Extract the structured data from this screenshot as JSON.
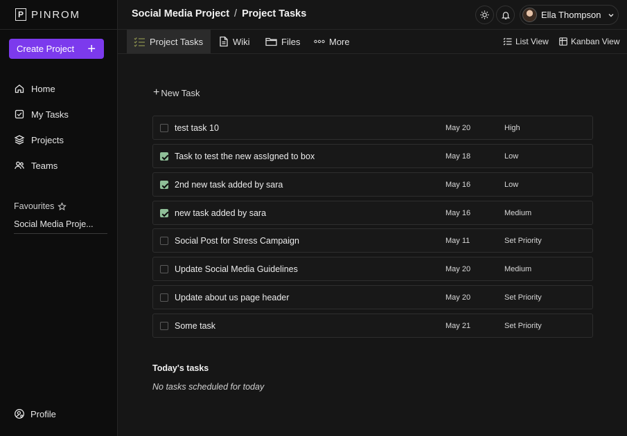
{
  "brand": {
    "logo_letter": "P",
    "name": "PINROM"
  },
  "sidebar": {
    "create_label": "Create Project",
    "nav": [
      {
        "label": "Home",
        "icon": "home-icon"
      },
      {
        "label": "My Tasks",
        "icon": "checkbox-icon"
      },
      {
        "label": "Projects",
        "icon": "layers-icon"
      },
      {
        "label": "Teams",
        "icon": "users-icon"
      }
    ],
    "favourites_label": "Favourites",
    "favourite_items": [
      "Social Media Proje..."
    ],
    "profile_label": "Profile"
  },
  "header": {
    "breadcrumb": [
      "Social Media Project",
      "Project Tasks"
    ],
    "separator": "/",
    "user_name": "Ella Thompson"
  },
  "tabs": [
    {
      "label": "Project Tasks",
      "active": true,
      "icon": "task-list-icon"
    },
    {
      "label": "Wiki",
      "active": false,
      "icon": "document-icon"
    },
    {
      "label": "Files",
      "active": false,
      "icon": "folder-icon"
    },
    {
      "label": "More",
      "active": false,
      "icon": "dots-icon"
    }
  ],
  "views": {
    "list_label": "List View",
    "kanban_label": "Kanban View"
  },
  "main": {
    "new_task_label": "New Task",
    "tasks": [
      {
        "title": "test task 10",
        "date": "May 20",
        "priority": "High",
        "done": false
      },
      {
        "title": "Task to test the new assIgned to box",
        "date": "May 18",
        "priority": "Low",
        "done": true
      },
      {
        "title": "2nd new task added by sara",
        "date": "May 16",
        "priority": "Low",
        "done": true
      },
      {
        "title": "new task added by sara",
        "date": "May 16",
        "priority": "Medium",
        "done": true
      },
      {
        "title": "Social Post for Stress Campaign",
        "date": "May 11",
        "priority": "Set Priority",
        "done": false
      },
      {
        "title": "Update Social Media Guidelines",
        "date": "May 20",
        "priority": "Medium",
        "done": false
      },
      {
        "title": "Update about us page header",
        "date": "May 20",
        "priority": "Set Priority",
        "done": false
      },
      {
        "title": "Some task",
        "date": "May 21",
        "priority": "Set Priority",
        "done": false
      }
    ],
    "today_title": "Today's tasks",
    "today_empty": "No tasks scheduled for today"
  },
  "colors": {
    "accent": "#7c3aed",
    "check": "#8fbf98",
    "background": "#161616",
    "sidebar": "#0d0d0d"
  }
}
